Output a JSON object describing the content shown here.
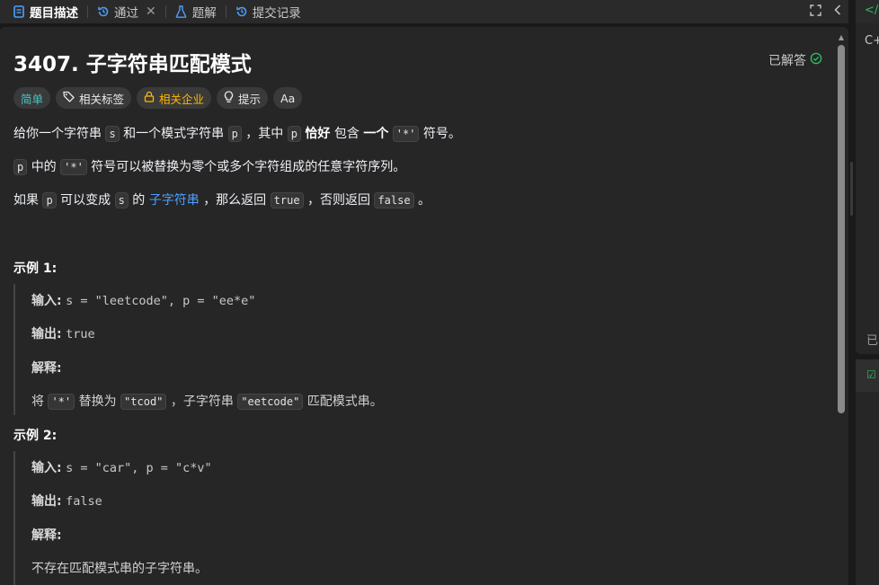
{
  "tabs": [
    {
      "label": "题目描述",
      "icon": "document-icon"
    },
    {
      "label": "通过",
      "icon": "history-icon"
    },
    {
      "label": "题解",
      "icon": "flask-icon"
    },
    {
      "label": "提交记录",
      "icon": "history-icon"
    }
  ],
  "problem": {
    "title": "3407. 子字符串匹配模式",
    "status": "已解答",
    "tags": {
      "difficulty": "简单",
      "related_tags": "相关标签",
      "related_companies": "相关企业",
      "hint": "提示",
      "translate": "Aa"
    },
    "desc1": {
      "t1": "给你一个字符串",
      "c1": "s",
      "t2": "和一个模式字符串",
      "c2": "p",
      "t3": "，其中",
      "c3": "p",
      "b1": "恰好",
      "t4": "包含",
      "b2": "一个",
      "c4": "'*'",
      "t5": "符号。"
    },
    "desc2": {
      "c1": "p",
      "t1": "中的",
      "c2": "'*'",
      "t2": "符号可以被替换为零个或多个字符组成的任意字符序列。"
    },
    "desc3": {
      "t1": "如果",
      "c1": "p",
      "t2": "可以变成",
      "c2": "s",
      "t3": "的",
      "link": "子字符串",
      "t4": "，那么返回",
      "c3": "true",
      "t5": "，否则返回",
      "c4": "false",
      "t6": "。"
    },
    "example1": {
      "title": "示例 1:",
      "input_label": "输入:",
      "input_value": "s = \"leetcode\", p = \"ee*e\"",
      "output_label": "输出:",
      "output_value": "true",
      "explain_label": "解释:",
      "explain": {
        "t1": "将",
        "c1": "'*'",
        "t2": "替换为",
        "c2": "\"tcod\"",
        "t3": "，子字符串",
        "c3": "\"eetcode\"",
        "t4": "匹配模式串。"
      }
    },
    "example2": {
      "title": "示例 2:",
      "input_label": "输入:",
      "input_value": "s = \"car\", p = \"c*v\"",
      "output_label": "输出:",
      "output_value": "false",
      "explain_label": "解释:",
      "explain_text": "不存在匹配模式串的子字符串。"
    }
  },
  "right_strip": {
    "glyph_top": "C+",
    "glyph_mid": "已"
  },
  "colors": {
    "easy": "#46c6c2",
    "company": "#ffb700",
    "link": "#4e9fff",
    "solved_check": "#2cbb5d"
  }
}
